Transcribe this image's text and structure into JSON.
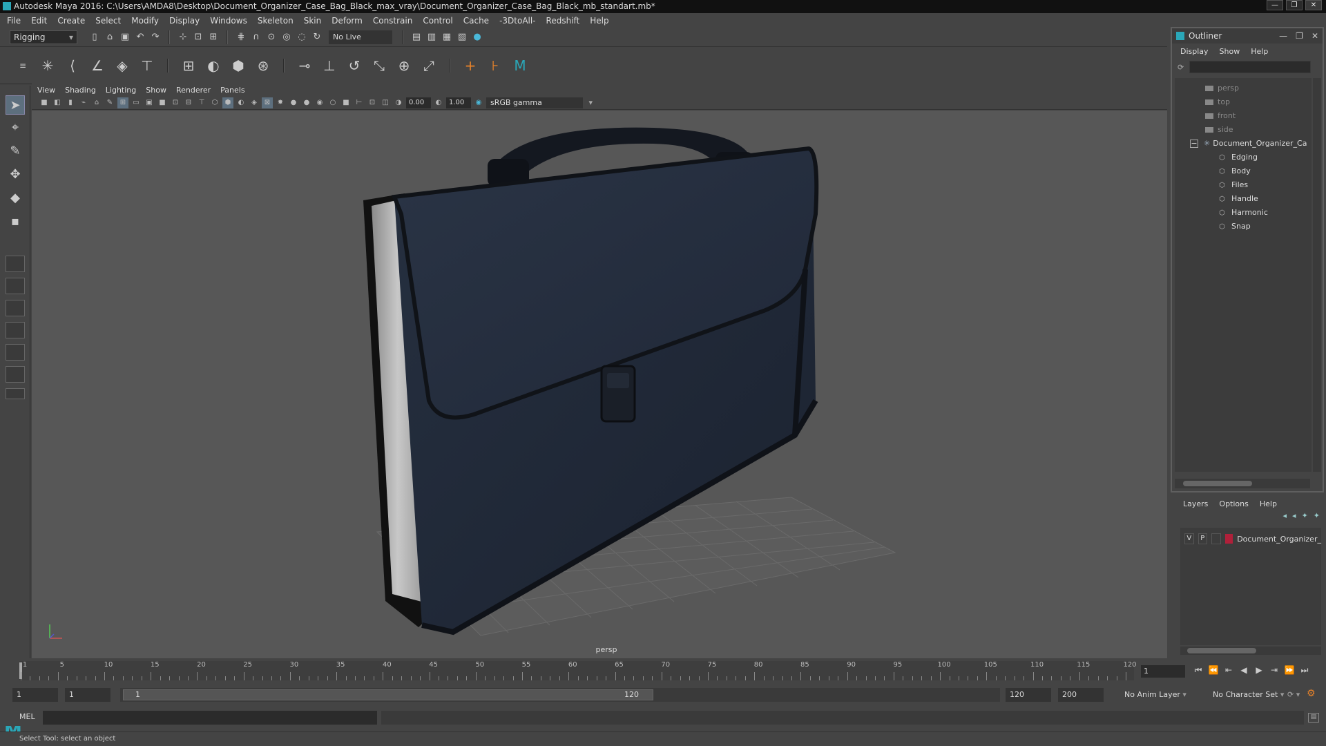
{
  "window": {
    "title": "Autodesk Maya 2016: C:\\Users\\AMDA8\\Desktop\\Document_Organizer_Case_Bag_Black_max_vray\\Document_Organizer_Case_Bag_Black_mb_standart.mb*",
    "controls": [
      "—",
      "❐",
      "✕"
    ]
  },
  "menubar": [
    "File",
    "Edit",
    "Create",
    "Select",
    "Modify",
    "Display",
    "Windows",
    "Skeleton",
    "Skin",
    "Deform",
    "Constrain",
    "Control",
    "Cache",
    "-3DtoAll-",
    "Redshift",
    "Help"
  ],
  "toolbar": {
    "menuset": "Rigging",
    "live_surface": "No Live Surface"
  },
  "viewport": {
    "menus": [
      "View",
      "Shading",
      "Lighting",
      "Show",
      "Renderer",
      "Panels"
    ],
    "exposure": "0.00",
    "gamma_value": "1.00",
    "color_space": "sRGB gamma",
    "camera_label": "persp"
  },
  "outliner": {
    "title": "Outliner",
    "menus": [
      "Display",
      "Show",
      "Help"
    ],
    "cameras": [
      "persp",
      "top",
      "front",
      "side"
    ],
    "group": "Document_Organizer_Ca",
    "children": [
      "Edging",
      "Body",
      "Files",
      "Handle",
      "Harmonic",
      "Snap"
    ]
  },
  "layers": {
    "menus": [
      "Layers",
      "Options",
      "Help"
    ],
    "row": {
      "v": "V",
      "p": "P",
      "name": "Document_Organizer_",
      "color": "#b0203a"
    }
  },
  "timeline": {
    "ticks": [
      "1",
      "5",
      "10",
      "15",
      "20",
      "25",
      "30",
      "35",
      "40",
      "45",
      "50",
      "55",
      "60",
      "65",
      "70",
      "75",
      "80",
      "85",
      "90",
      "95",
      "100",
      "105",
      "110",
      "115",
      "120"
    ],
    "tick_values": [
      1,
      5,
      10,
      15,
      20,
      25,
      30,
      35,
      40,
      45,
      50,
      55,
      60,
      65,
      70,
      75,
      80,
      85,
      90,
      95,
      100,
      105,
      110,
      115,
      120
    ],
    "current_frame": "1"
  },
  "range": {
    "start": "1",
    "playback_start": "1",
    "slider_start": "1",
    "slider_end": "120",
    "playback_end": "120",
    "end": "200",
    "anim_layer": "No Anim Layer",
    "character_set": "No Character Set"
  },
  "command": {
    "label": "MEL"
  },
  "help_line": "Select Tool: select an object",
  "colors": {
    "accent": "#2aa7b8",
    "layer_color": "#b0203a",
    "bag": "#1f2633"
  }
}
